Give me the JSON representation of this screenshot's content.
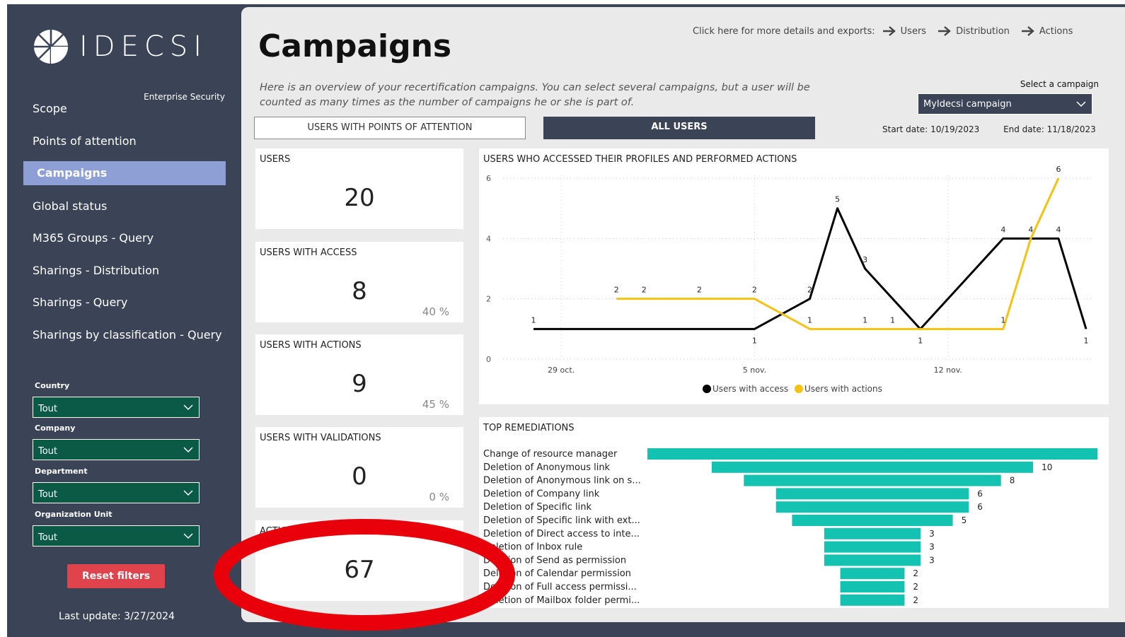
{
  "brand": {
    "name": "IDECSI",
    "subtitle": "Enterprise Security"
  },
  "sidebar": {
    "nav": [
      {
        "label": "Scope"
      },
      {
        "label": "Points of attention"
      },
      {
        "label": "Campaigns",
        "active": true
      },
      {
        "label": "Global status"
      },
      {
        "label": "M365 Groups - Query"
      },
      {
        "label": "Sharings - Distribution"
      },
      {
        "label": "Sharings - Query"
      },
      {
        "label": "Sharings by classification - Query"
      }
    ],
    "filters": [
      {
        "label": "Country",
        "value": "Tout"
      },
      {
        "label": "Company",
        "value": "Tout"
      },
      {
        "label": "Department",
        "value": "Tout"
      },
      {
        "label": "Organization Unit",
        "value": "Tout"
      }
    ],
    "reset_label": "Reset filters",
    "last_update_label": "Last update:",
    "last_update_value": "3/27/2024"
  },
  "main": {
    "title": "Campaigns",
    "details_prompt": "Click here for more details and exports:",
    "detail_links": [
      "Users",
      "Distribution",
      "Actions"
    ],
    "description": "Here is an overview of your recertification campaigns. You can select several campaigns, but a user will be counted as many times as the number of campaigns he or she is part of.",
    "select_label": "Select a campaign",
    "selected_campaign": "MyIdecsi campaign",
    "start_date_label": "Start date:",
    "start_date": "10/19/2023",
    "end_date_label": "End date:",
    "end_date": "11/18/2023",
    "tabs": [
      "USERS WITH POINTS OF ATTENTION",
      "ALL USERS"
    ],
    "active_tab": "ALL USERS",
    "cards": [
      {
        "label": "USERS",
        "value": "20",
        "pct": ""
      },
      {
        "label": "USERS WITH ACCESS",
        "value": "8",
        "pct": "40 %"
      },
      {
        "label": "USERS WITH ACTIONS",
        "value": "9",
        "pct": "45 %"
      },
      {
        "label": "USERS WITH VALIDATIONS",
        "value": "0",
        "pct": "0 %"
      },
      {
        "label": "ACTIONS PERFORMED",
        "value": "67",
        "pct": ""
      }
    ],
    "line_chart_title": "USERS WHO ACCESSED THEIR PROFILES AND PERFORMED ACTIONS",
    "remediations_title": "TOP REMEDIATIONS"
  },
  "chart_data": [
    {
      "type": "line",
      "title": "USERS WHO ACCESSED THEIR PROFILES AND PERFORMED ACTIONS",
      "x_ticks": [
        "29 oct.",
        "5 nov.",
        "12 nov."
      ],
      "ylim": [
        0,
        6
      ],
      "y_ticks": [
        0,
        2,
        4,
        6
      ],
      "grid": true,
      "legend_position": "bottom",
      "series": [
        {
          "name": "Users with access",
          "color": "#000000",
          "points": [
            {
              "x": "10/28/2023",
              "y": 1,
              "label": "1"
            },
            {
              "x": "11/5/2023",
              "y": 1,
              "label": "1"
            },
            {
              "x": "11/7/2023",
              "y": 2,
              "label": "2"
            },
            {
              "x": "11/8/2023",
              "y": 5,
              "label": "5"
            },
            {
              "x": "11/9/2023",
              "y": 3,
              "label": "3"
            },
            {
              "x": "11/11/2023",
              "y": 1,
              "label": "1"
            },
            {
              "x": "11/14/2023",
              "y": 4,
              "label": "4"
            },
            {
              "x": "11/16/2023",
              "y": 4,
              "label": "4"
            },
            {
              "x": "11/17/2023",
              "y": 1,
              "label": "1"
            }
          ]
        },
        {
          "name": "Users with actions",
          "color": "#f5c211",
          "points": [
            {
              "x": "10/31/2023",
              "y": 2,
              "label": "2"
            },
            {
              "x": "11/1/2023",
              "y": 2,
              "label": "2"
            },
            {
              "x": "11/3/2023",
              "y": 2,
              "label": "2"
            },
            {
              "x": "11/5/2023",
              "y": 2,
              "label": "2"
            },
            {
              "x": "11/7/2023",
              "y": 1,
              "label": "1"
            },
            {
              "x": "11/9/2023",
              "y": 1,
              "label": "1"
            },
            {
              "x": "11/10/2023",
              "y": 1,
              "label": "1"
            },
            {
              "x": "11/14/2023",
              "y": 1,
              "label": "1"
            },
            {
              "x": "11/15/2023",
              "y": 4,
              "label": "4"
            },
            {
              "x": "11/16/2023",
              "y": 6,
              "label": "6"
            }
          ]
        }
      ]
    },
    {
      "type": "bar",
      "orientation": "horizontal-funnel",
      "title": "TOP REMEDIATIONS",
      "color": "#13c2b0",
      "categories": [
        "Change of resource manager",
        "Deletion of Anonymous link",
        "Deletion of Anonymous link on s...",
        "Deletion of Company link",
        "Deletion of Specific link",
        "Deletion of Specific link with ext...",
        "Deletion of Direct access to inte...",
        "Deletion of Inbox rule",
        "Deletion of Send as permission",
        "Deletion of Calendar permission",
        "Deletion of Full access permissi...",
        "Deletion of Mailbox folder permi..."
      ],
      "values": [
        14,
        10,
        8,
        6,
        6,
        5,
        3,
        3,
        3,
        2,
        2,
        2
      ],
      "value_labels": [
        "",
        "10",
        "8",
        "6",
        "6",
        "5",
        "3",
        "3",
        "3",
        "2",
        "2",
        "2"
      ]
    }
  ],
  "colors": {
    "sidebar_bg": "#3b4456",
    "active_nav": "#8e9fd6",
    "filter_bg": "#0b5a46",
    "reset": "#e0434b",
    "teal": "#13c2b0",
    "yellow": "#f5c211",
    "annotation": "#e8000b"
  }
}
